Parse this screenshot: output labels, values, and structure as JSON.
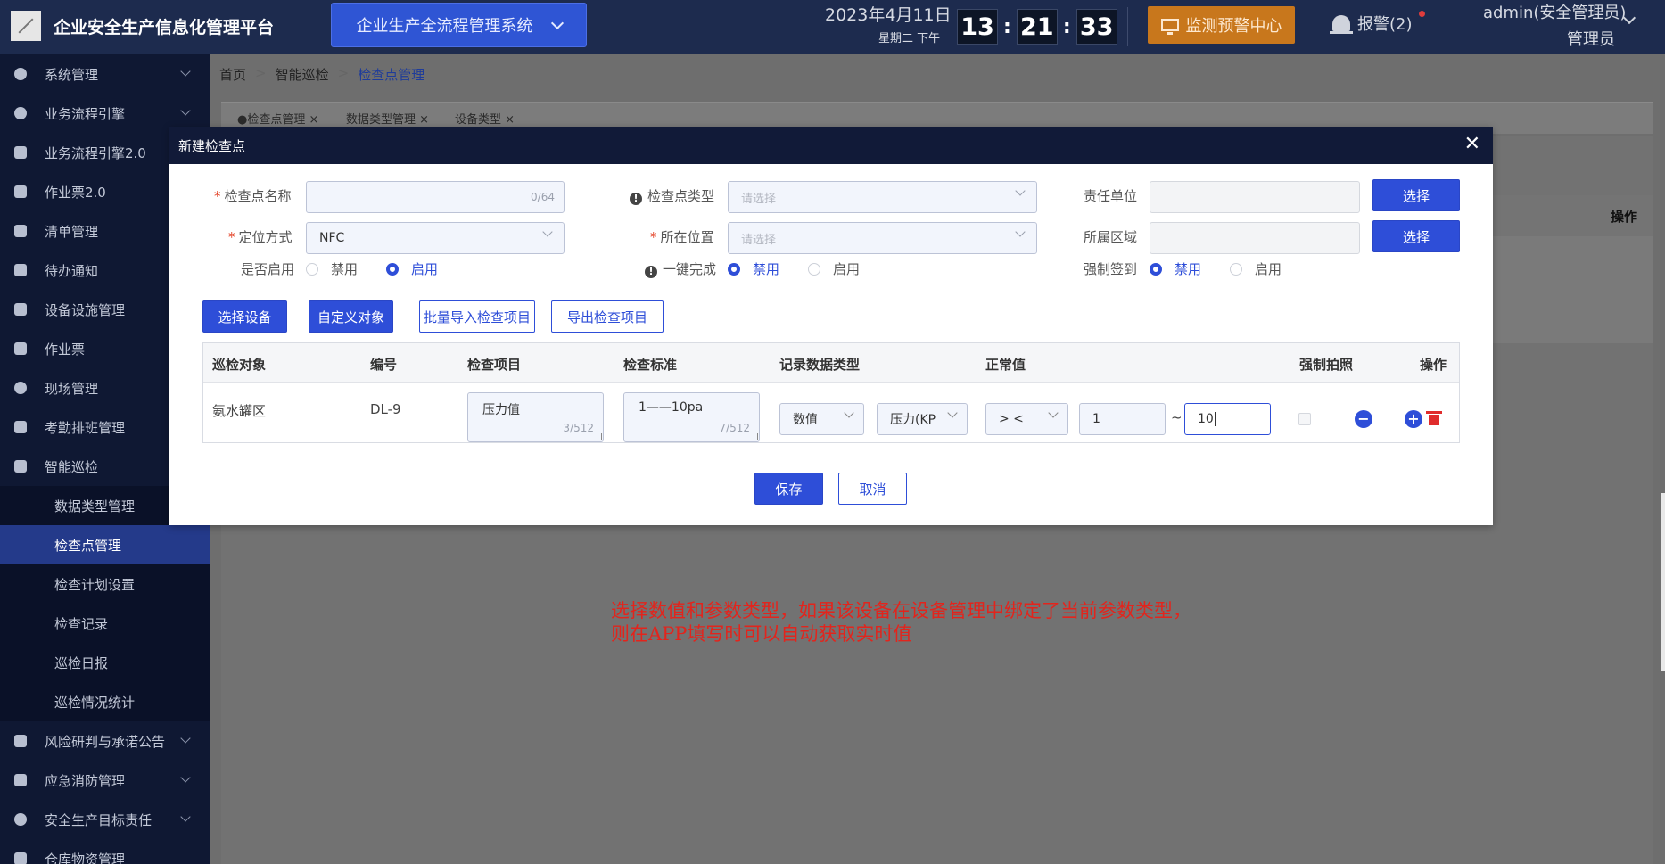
{
  "header": {
    "app_title": "企业安全生产信息化管理平台",
    "system_select": "企业生产全流程管理系统",
    "date": "2023年4月11日",
    "weekday": "星期二 下午",
    "clock": {
      "h": "13",
      "m": "21",
      "s": "33"
    },
    "monitor_button": "监测预警中心",
    "alarm": "报警(2)",
    "user": "admin(安全管理员)",
    "role": "管理员"
  },
  "sidebar": {
    "items": [
      {
        "label": "系统管理",
        "icon": "gear-icon"
      },
      {
        "label": "业务流程引擎",
        "icon": "globe-icon"
      },
      {
        "label": "业务流程引擎2.0",
        "icon": "sitemap-icon"
      },
      {
        "label": "作业票2.0",
        "icon": "user-icon"
      },
      {
        "label": "清单管理",
        "icon": "list-icon"
      },
      {
        "label": "待办通知",
        "icon": "mail-icon"
      },
      {
        "label": "设备设施管理",
        "icon": "sitemap-icon"
      },
      {
        "label": "作业票",
        "icon": "ticket-icon"
      },
      {
        "label": "现场管理",
        "icon": "globe-icon"
      },
      {
        "label": "考勤排班管理",
        "icon": "bar-chart-icon"
      },
      {
        "label": "智能巡检",
        "icon": "grid-icon"
      }
    ],
    "subitems": [
      {
        "label": "数据类型管理"
      },
      {
        "label": "检查点管理"
      },
      {
        "label": "检查计划设置"
      },
      {
        "label": "检查记录"
      },
      {
        "label": "巡检日报"
      },
      {
        "label": "巡检情况统计"
      }
    ],
    "items_after": [
      {
        "label": "风险研判与承诺公告",
        "icon": "briefcase-icon"
      },
      {
        "label": "应急消防管理",
        "icon": "extinguisher-icon"
      },
      {
        "label": "安全生产目标责任",
        "icon": "target-icon"
      },
      {
        "label": "仓库物资管理",
        "icon": "folder-icon"
      }
    ]
  },
  "breadcrumb": {
    "home": "首页",
    "section": "智能巡检",
    "current": "检查点管理"
  },
  "tabs": [
    {
      "label": "●检查点管理"
    },
    {
      "label": "数据类型管理"
    },
    {
      "label": "设备类型"
    }
  ],
  "background_table": {
    "op_header": "操作"
  },
  "modal": {
    "title": "新建检查点",
    "form": {
      "name_label": "检查点名称",
      "name_count": "0/64",
      "type_label": "检查点类型",
      "type_placeholder": "请选择",
      "unit_label": "责任单位",
      "unit_button": "选择",
      "locate_label": "定位方式",
      "locate_value": "NFC",
      "position_label": "所在位置",
      "position_placeholder": "请选择",
      "area_label": "所属区域",
      "area_button": "选择",
      "enable_label": "是否启用",
      "enable_off": "禁用",
      "enable_on": "启用",
      "onekey_label": "一键完成",
      "onekey_off": "禁用",
      "onekey_on": "启用",
      "signin_label": "强制签到",
      "signin_off": "禁用",
      "signin_on": "启用"
    },
    "actions": {
      "select_device": "选择设备",
      "custom_object": "自定义对象",
      "batch_import": "批量导入检查项目",
      "export": "导出检查项目"
    },
    "table": {
      "headers": [
        "巡检对象",
        "编号",
        "检查项目",
        "检查标准",
        "记录数据类型",
        "正常值",
        "强制拍照",
        "操作"
      ],
      "row": {
        "object": "氨水罐区",
        "code": "DL-9",
        "item": "压力值",
        "item_count": "3/512",
        "standard": "1——10pa",
        "standard_count": "7/512",
        "data_type": "数值",
        "param_type": "压力(KP",
        "operator": "> <",
        "min": "1",
        "range_sep": "~",
        "max": "10"
      }
    },
    "save": "保存",
    "cancel": "取消"
  },
  "annotation": {
    "line1": "选择数值和参数类型，如果该设备在设备管理中绑定了当前参数类型，",
    "line2": "则在APP填写时可以自动获取实时值"
  }
}
